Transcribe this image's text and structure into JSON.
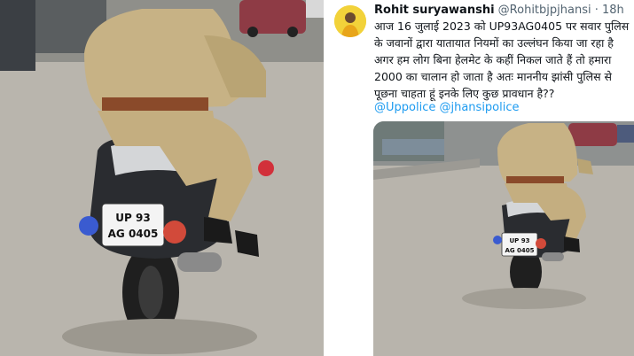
{
  "photo_left": {
    "plate_line1": "UP 93",
    "plate_line2": "AG 0405"
  },
  "tweet": {
    "author_name": "Rohit suryawanshi",
    "handle": "@Rohitbjpjhansi",
    "separator": "·",
    "time": "18h",
    "text": "आज 16 जुलाई 2023 को UP93AG0405 पर सवार पुलिस के जवानों द्वारा यातायात नियमों का उल्लंघन किया जा रहा है अगर हम लोग बिना हेलमेट के कहीं निकल जाते हैं तो हमारा 2000 का चालान हो जाता है अतः माननीय झांसी पुलिस से पूछना चाहता हूं इनके लिए कुछ प्रावधान है??",
    "mentions": [
      "@Uppolice",
      "@jhansipolice"
    ],
    "media": {
      "plate_line1": "UP 93",
      "plate_line2": "AG 0405"
    }
  },
  "colors": {
    "link": "#1d9bf0",
    "uniform": "#c9b48a",
    "road": "#b7b3ab",
    "avatar_bg": "#f2d23a"
  }
}
